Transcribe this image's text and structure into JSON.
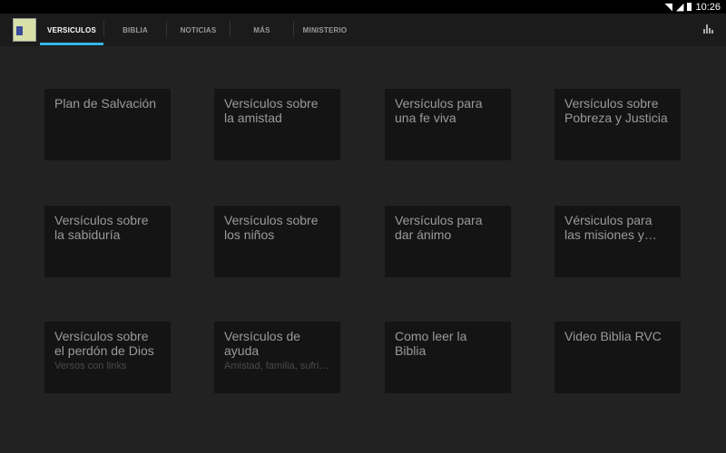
{
  "status": {
    "time": "10:26",
    "icons": [
      "wifi-icon",
      "signal-icon",
      "battery-icon"
    ]
  },
  "tabs": [
    {
      "label": "VERSICULOS",
      "selected": true
    },
    {
      "label": "BIBLIA"
    },
    {
      "label": "NOTICIAS"
    },
    {
      "label": "MÁS"
    },
    {
      "label": "MINISTERIO"
    }
  ],
  "cards": [
    {
      "title": "Plan de Salvación"
    },
    {
      "title": "Versículos sobre la amistad"
    },
    {
      "title": "Versículos para una fe viva"
    },
    {
      "title": "Versículos sobre Pobreza y Justicia"
    },
    {
      "title": "Versículos sobre la sabiduría"
    },
    {
      "title": "Versículos sobre los niños"
    },
    {
      "title": "Versículos para dar ánimo"
    },
    {
      "title": "Vérsiculos para las misiones y…"
    },
    {
      "title": "Versículos sobre el perdón de Dios",
      "subtitle": "Versos con links"
    },
    {
      "title": "Versículos de ayuda",
      "subtitle": "Amistad, familia, sufri…"
    },
    {
      "title": "Como leer la Biblia"
    },
    {
      "title": "Video Biblia RVC"
    }
  ],
  "colors": {
    "accent": "#33b5e5",
    "card": "#141414",
    "background": "#222222"
  }
}
